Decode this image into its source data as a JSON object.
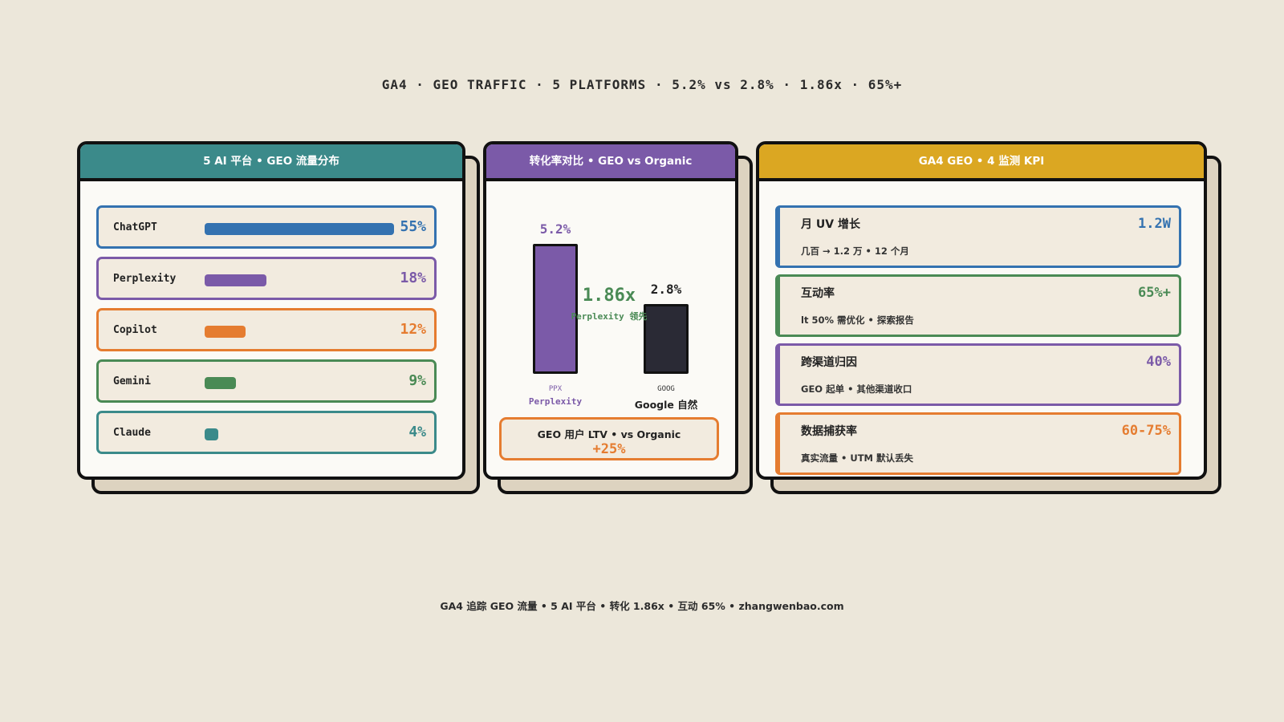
{
  "title": "GA4 · GEO TRAFFIC · 5 PLATFORMS · 5.2% vs 2.8% · 1.86x · 65%+",
  "footer": "GA4 追踪 GEO 流量 • 5 AI 平台 • 转化 1.86x • 互动 65% • zhangwenbao.com",
  "colors": {
    "teal": "#3b8a8a",
    "purple": "#7b5aa8",
    "gold": "#dba722",
    "blue": "#3472b0",
    "orange": "#e57c30",
    "green": "#4a8a55",
    "dark": "#2a2a35"
  },
  "panels": {
    "platforms": {
      "header": "5 AI 平台 • GEO 流量分布"
    },
    "conversion": {
      "header": "转化率对比 • GEO vs Organic"
    },
    "kpi": {
      "header": "GA4 GEO • 4 监测 KPI"
    }
  },
  "chart_data": [
    {
      "type": "bar",
      "title": "5 AI 平台 • GEO 流量分布",
      "orientation": "horizontal",
      "categories": [
        "ChatGPT",
        "Perplexity",
        "Copilot",
        "Gemini",
        "Claude"
      ],
      "values": [
        55,
        18,
        12,
        9,
        4
      ],
      "labels": [
        "55%",
        "18%",
        "12%",
        "9%",
        "4%"
      ],
      "colors": [
        "#3472b0",
        "#7b5aa8",
        "#e57c30",
        "#4a8a55",
        "#3b8a8a"
      ],
      "xlim": [
        0,
        55
      ]
    },
    {
      "type": "bar",
      "title": "转化率对比 • GEO vs Organic",
      "categories": [
        "Perplexity",
        "Google 自然"
      ],
      "short_labels": [
        "PPX",
        "GOOG"
      ],
      "values": [
        5.2,
        2.8
      ],
      "labels": [
        "5.2%",
        "2.8%"
      ],
      "colors": [
        "#7b5aa8",
        "#2a2a35"
      ],
      "ylim": [
        0,
        5.2
      ],
      "annotation": {
        "value": "1.86x",
        "text": "Perplexity 领先"
      },
      "ltv": {
        "label": "GEO 用户 LTV • vs Organic",
        "value": "+25%"
      }
    }
  ],
  "kpis": [
    {
      "title": "月 UV 增长",
      "value": "1.2W",
      "sub": "几百 → 1.2 万 • 12 个月",
      "color": "#3472b0"
    },
    {
      "title": "互动率",
      "value": "65%+",
      "sub": "lt 50% 需优化 • 探索报告",
      "color": "#4a8a55"
    },
    {
      "title": "跨渠道归因",
      "value": "40%",
      "sub": "GEO 起单 • 其他渠道收口",
      "color": "#7b5aa8"
    },
    {
      "title": "数据捕获率",
      "value": "60-75%",
      "sub": "真实流量 • UTM 默认丢失",
      "color": "#e57c30"
    }
  ]
}
